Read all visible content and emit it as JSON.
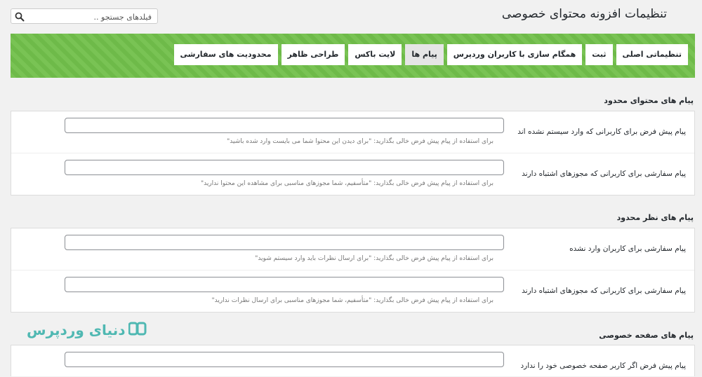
{
  "page": {
    "title": "تنظیمات افزونه محتوای خصوصی"
  },
  "search": {
    "placeholder": "فیلدهای جستجو .."
  },
  "tabs": [
    {
      "label": "تنظیماتی اصلی",
      "active": false
    },
    {
      "label": "ثبت",
      "active": false
    },
    {
      "label": "همگام سازی با کاربران وردپرس",
      "active": false
    },
    {
      "label": "پیام ها",
      "active": true
    },
    {
      "label": "لایت باکس",
      "active": false
    },
    {
      "label": "طراحی ظاهر",
      "active": false
    },
    {
      "label": "محدودیت های سفارشی",
      "active": false
    }
  ],
  "sections": [
    {
      "title": "پیام های محتوای محدود",
      "rows": [
        {
          "label": "پیام پیش فرض برای کاربرانی که وارد سیستم نشده اند",
          "value": "",
          "hint": "برای استفاده از پیام پیش فرض خالی بگذارید: \"برای دیدن این محتوا شما می بایست وارد شده باشید\""
        },
        {
          "label": "پیام سفارشی برای کاربرانی که مجوزهای اشتباه دارند",
          "value": "",
          "hint": "برای استفاده از پیام پیش فرض خالی بگذارید: \"متأسفیم، شما مجوزهای مناسبی برای مشاهده این محتوا ندارید\""
        }
      ]
    },
    {
      "title": "پیام های نظر محدود",
      "rows": [
        {
          "label": "پیام سفارشی برای کاربران وارد نشده",
          "value": "",
          "hint": "برای استفاده از پیام پیش فرض خالی بگذارید: \"برای ارسال نظرات باید وارد سیستم شوید\""
        },
        {
          "label": "پیام سفارشی برای کاربرانی که مجوزهای اشتباه دارند",
          "value": "",
          "hint": "برای استفاده از پیام پیش فرض خالی بگذارید: \"متأسفیم، شما مجوزهای مناسبی برای ارسال نظرات ندارید\""
        }
      ]
    },
    {
      "title": "پیام های صفحه خصوصی",
      "rows": [
        {
          "label": "پیام پیش فرض اگر کاربر صفحه خصوصی خود را ندارد",
          "value": "",
          "hint": ""
        }
      ]
    }
  ],
  "watermark": {
    "text": "دنیای وردپرس",
    "logo_icon": "wp-dunya-logo",
    "color": "#4fb8b2"
  },
  "colors": {
    "banner": "#72c04b",
    "active_tab": "#e5e5e5"
  },
  "icons": {
    "search": "search-icon"
  }
}
